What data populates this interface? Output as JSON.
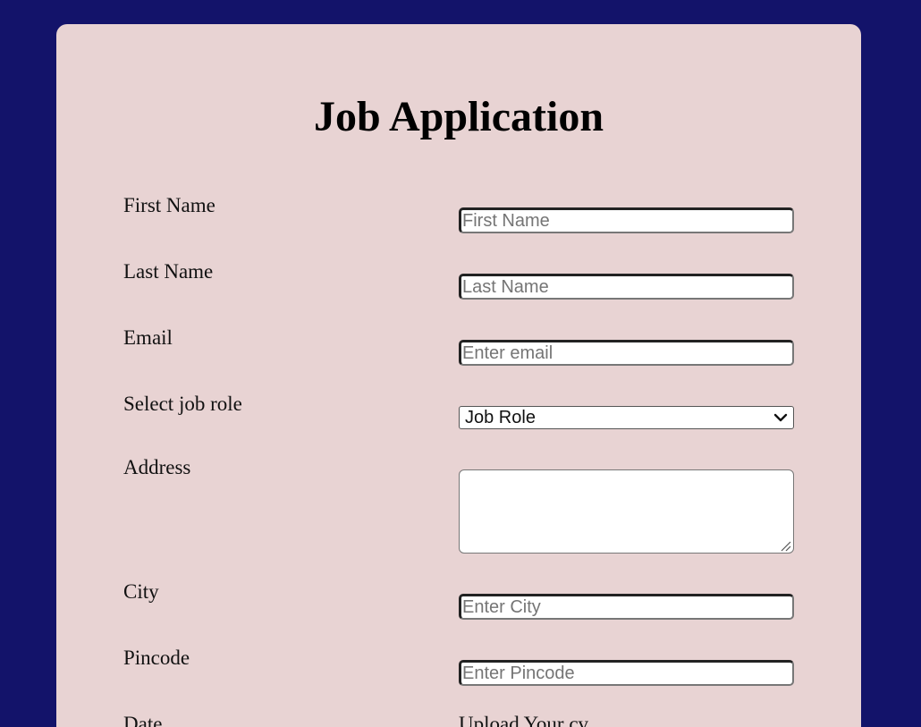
{
  "form": {
    "title": "Job Application",
    "first_name": {
      "label": "First Name",
      "placeholder": "First Name",
      "value": ""
    },
    "last_name": {
      "label": "Last Name",
      "placeholder": "Last Name",
      "value": ""
    },
    "email": {
      "label": "Email",
      "placeholder": "Enter email",
      "value": ""
    },
    "job_role": {
      "label": "Select job role",
      "selected": "Job Role"
    },
    "address": {
      "label": "Address",
      "value": ""
    },
    "city": {
      "label": "City",
      "placeholder": "Enter City",
      "value": ""
    },
    "pincode": {
      "label": "Pincode",
      "placeholder": "Enter Pincode",
      "value": ""
    },
    "date": {
      "label": "Date"
    },
    "cv": {
      "label": "Upload Your cv"
    }
  },
  "colors": {
    "page_background": "#13136a",
    "card_background": "#e8d3d3",
    "field_background": "#ffffff"
  },
  "icons": {
    "select_arrow": "chevron-down-icon",
    "textarea_grip": "resize-grip-icon"
  }
}
